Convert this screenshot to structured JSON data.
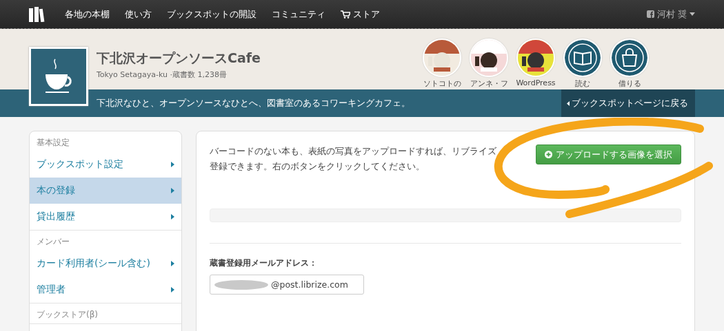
{
  "nav": {
    "items": [
      {
        "label": "各地の本棚",
        "kind": "link"
      },
      {
        "label": "使い方",
        "kind": "link"
      },
      {
        "label": "ブックスポットの開設",
        "kind": "link"
      },
      {
        "label": "コミュニティ",
        "kind": "link"
      },
      {
        "label": "ストア",
        "kind": "cart"
      }
    ],
    "user": {
      "name": "河村 奨"
    }
  },
  "header": {
    "title": "下北沢オープンソースCafe",
    "subtitle": "Tokyo Setagaya-ku ·蔵書数 1,238冊",
    "tagline": "下北沢なひと、オープンソースなひとへ、図書室のあるコワーキングカフェ。",
    "back_button": "ブックスポットページに戻る",
    "shelves": [
      {
        "label": "ソトコトの",
        "kind": "picture"
      },
      {
        "label": "アンネ・フ",
        "kind": "picture"
      },
      {
        "label": "WordPress",
        "kind": "picture"
      },
      {
        "label": "読む",
        "kind": "read"
      },
      {
        "label": "借りる",
        "kind": "borrow"
      }
    ]
  },
  "sidebar": {
    "sections": [
      {
        "heading": "基本設定",
        "items": [
          {
            "label": "ブックスポット設定",
            "selected": false
          },
          {
            "label": "本の登録",
            "selected": true
          },
          {
            "label": "貸出履歴",
            "selected": false
          }
        ]
      },
      {
        "heading": "メンバー",
        "items": [
          {
            "label": "カード利用者(シール含む)",
            "selected": false
          },
          {
            "label": "管理者",
            "selected": false
          }
        ]
      },
      {
        "heading": "ブックストア(β)"
      }
    ]
  },
  "main": {
    "description": [
      "バーコードのない本も、表紙の写真をアップロードすれば、リブライズ",
      "登録できます。右のボタンをクリックしてください。"
    ],
    "upload_button": "アップロードする画像を選択",
    "email_label": "蔵書登録用メールアドレス：",
    "email_value": "@post.librize.com"
  }
}
